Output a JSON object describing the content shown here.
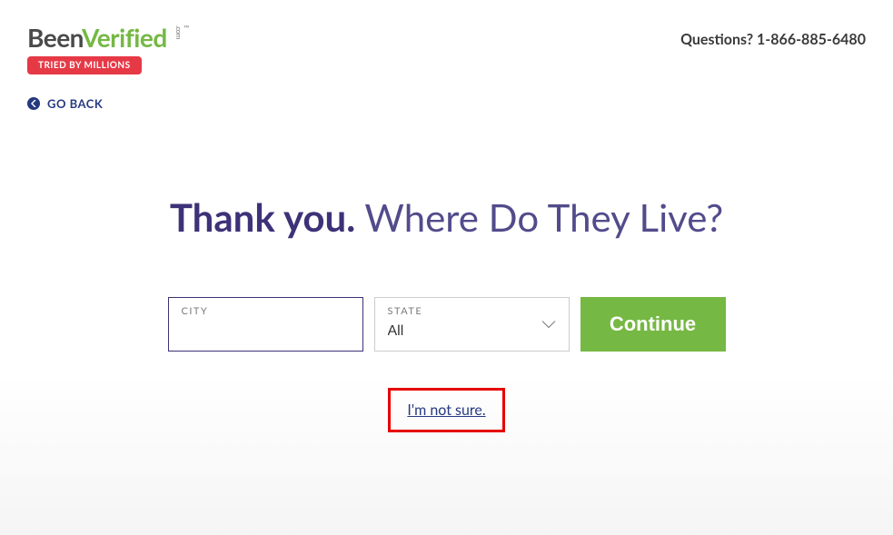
{
  "header": {
    "logo_been": "Been",
    "logo_verified": "Verified",
    "logo_com": ".com",
    "logo_tm": "™",
    "badge": "TRIED BY MILLIONS",
    "questions": "Questions? 1-866-885-6480"
  },
  "nav": {
    "go_back": "GO BACK"
  },
  "main": {
    "heading_bold": "Thank you.",
    "heading_rest": " Where Do They Live?"
  },
  "form": {
    "city_label": "CITY",
    "city_value": "",
    "state_label": "STATE",
    "state_value": "All",
    "continue": "Continue",
    "not_sure": "I'm not sure."
  }
}
